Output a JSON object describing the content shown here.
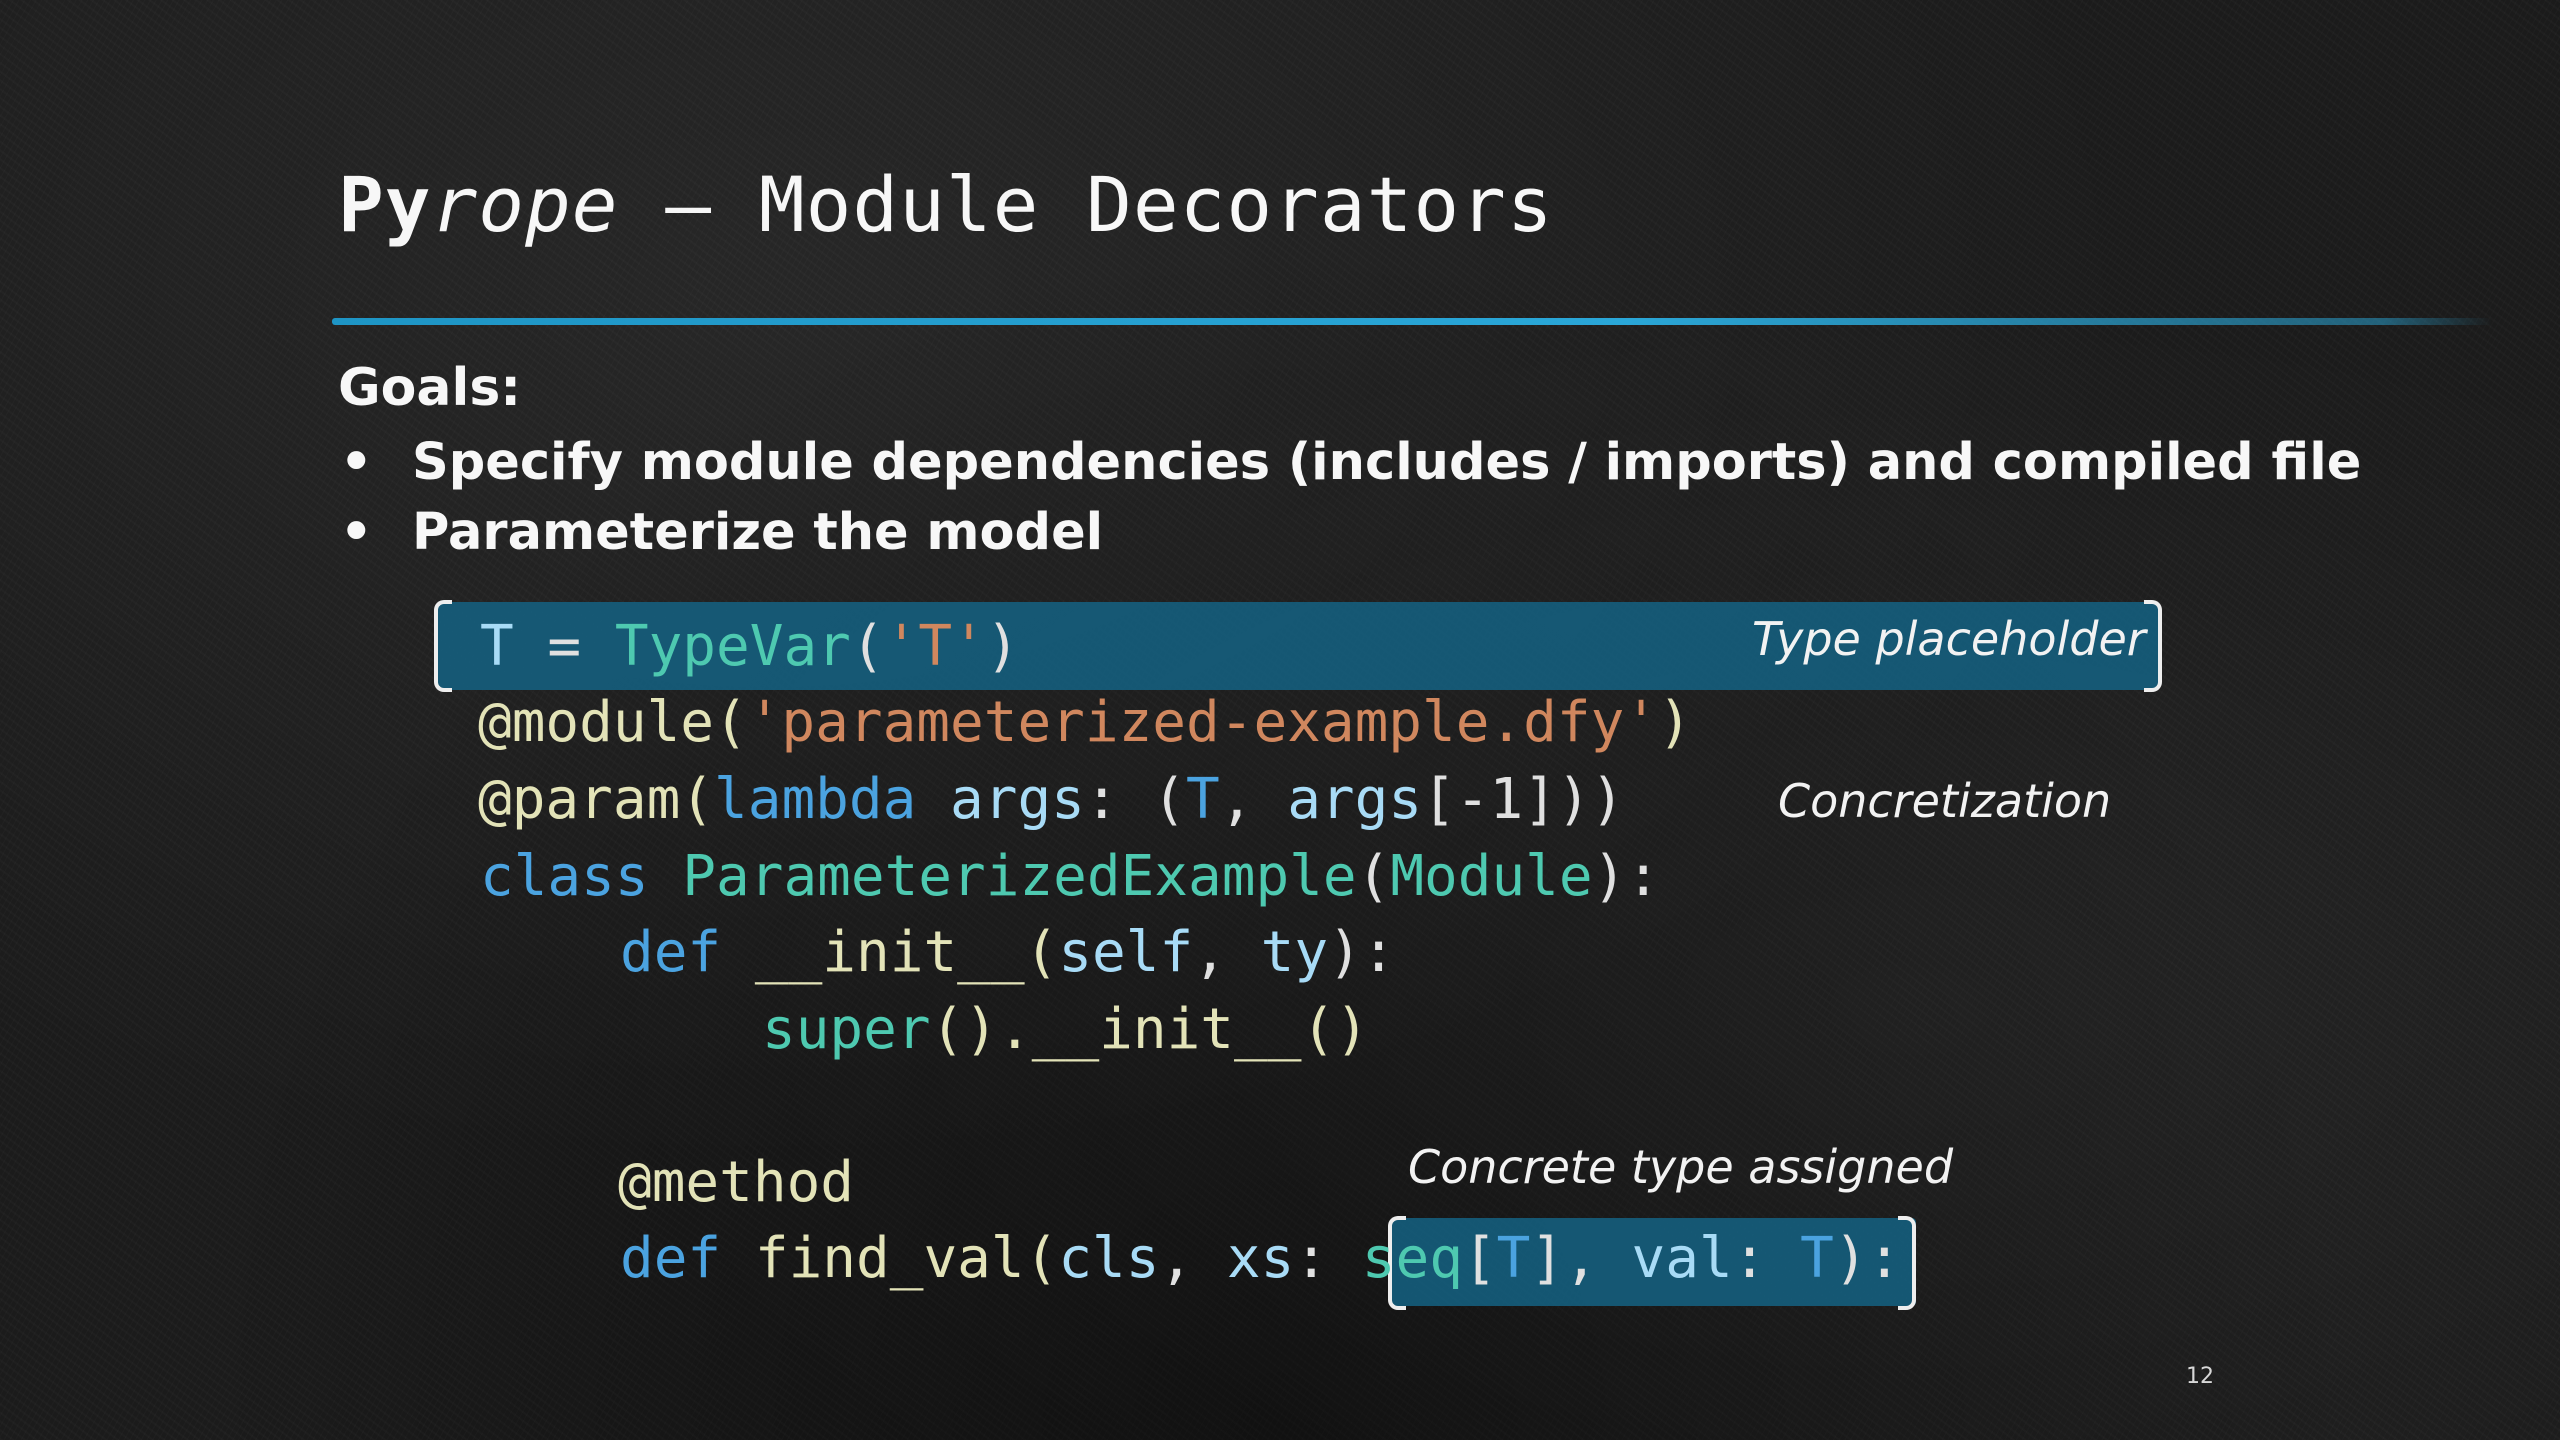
{
  "title": {
    "bold": "Py",
    "italic": "rope",
    "rest": " – Module Decorators"
  },
  "goals_label": "Goals:",
  "bullets": [
    "Specify module dependencies (includes / imports) and compiled file",
    "Parameterize the model"
  ],
  "bullet_glyph": "•",
  "code": {
    "l1": {
      "a": "T",
      "b": " = ",
      "c": "TypeVar",
      "d": "(",
      "e": "'T'",
      "f": ")"
    },
    "l2": {
      "a": "@module(",
      "b": "'parameterized-example.dfy'",
      "c": ")"
    },
    "l3": {
      "a": "@param(",
      "b": "lambda",
      "c": " ",
      "d": "args",
      "e": ": (",
      "f": "T",
      "g": ", ",
      "h": "args",
      "i": "[-1]))"
    },
    "l4": {
      "a": "class",
      "b": " ",
      "c": "ParameterizedExample",
      "d": "(",
      "e": "Module",
      "f": "):"
    },
    "l5": {
      "a": "def",
      "b": " __init__(",
      "c": "self",
      "d": ", ",
      "e": "ty",
      "f": "):"
    },
    "l6": {
      "a": "super",
      "b": "().__init__()"
    },
    "l7": {
      "a": "@method"
    },
    "l8": {
      "a": "def",
      "b": " find_val(",
      "c": "cls",
      "d": ", ",
      "e": "xs",
      "f": ": ",
      "g": "seq",
      "h": "[",
      "i": "T",
      "j": "], ",
      "k": "val",
      "l": ": ",
      "m": "T",
      "n": "):"
    }
  },
  "annotations": {
    "type_placeholder": "Type placeholder",
    "concretization": "Concretization",
    "concrete_type": "Concrete type assigned"
  },
  "page_number": "12",
  "colors": {
    "accent_rule": "#2aa7d8",
    "highlight": "#156080",
    "keyword": "#4ba3e0",
    "function": "#4ec9b0",
    "string": "#d0875e",
    "identifier": "#a8dbf6",
    "decorator": "#e3e3b8"
  }
}
